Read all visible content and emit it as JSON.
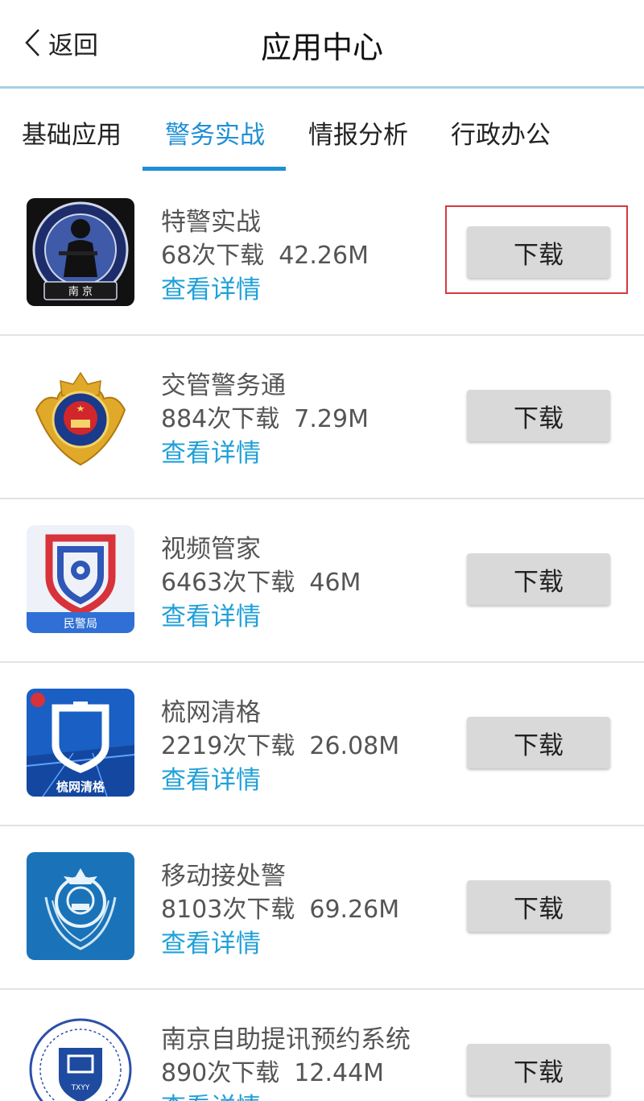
{
  "header": {
    "back_label": "返回",
    "title": "应用中心"
  },
  "tabs": [
    {
      "label": "基础应用",
      "active": false
    },
    {
      "label": "警务实战",
      "active": true
    },
    {
      "label": "情报分析",
      "active": false
    },
    {
      "label": "行政办公",
      "active": false
    }
  ],
  "apps": [
    {
      "name": "特警实战",
      "downloads": "68次下载",
      "size": "42.26M",
      "detail_label": "查看详情",
      "button_label": "下载",
      "icon": "swat-badge-icon",
      "icon_text": "南 京"
    },
    {
      "name": "交管警务通",
      "downloads": "884次下载",
      "size": "7.29M",
      "detail_label": "查看详情",
      "button_label": "下载",
      "icon": "police-emblem-icon"
    },
    {
      "name": "视频管家",
      "downloads": "6463次下载",
      "size": "46M",
      "detail_label": "查看详情",
      "button_label": "下载",
      "icon": "video-shield-icon",
      "icon_text": "民警局"
    },
    {
      "name": "梳网清格",
      "downloads": "2219次下载",
      "size": "26.08M",
      "detail_label": "查看详情",
      "button_label": "下载",
      "icon": "grid-shield-icon",
      "icon_text": "梳网清格"
    },
    {
      "name": "移动接处警",
      "downloads": "8103次下载",
      "size": "69.26M",
      "detail_label": "查看详情",
      "button_label": "下载",
      "icon": "national-emblem-icon"
    },
    {
      "name": "南京自助提讯预约系统",
      "downloads": "890次下载",
      "size": "12.44M",
      "detail_label": "查看详情",
      "button_label": "下载",
      "icon": "round-seal-icon",
      "icon_text": "TXYY"
    }
  ],
  "colors": {
    "accent": "#1f8fd6",
    "link": "#1fa0d8",
    "highlight": "#d6393f",
    "button_bg": "#d9d9d9"
  }
}
